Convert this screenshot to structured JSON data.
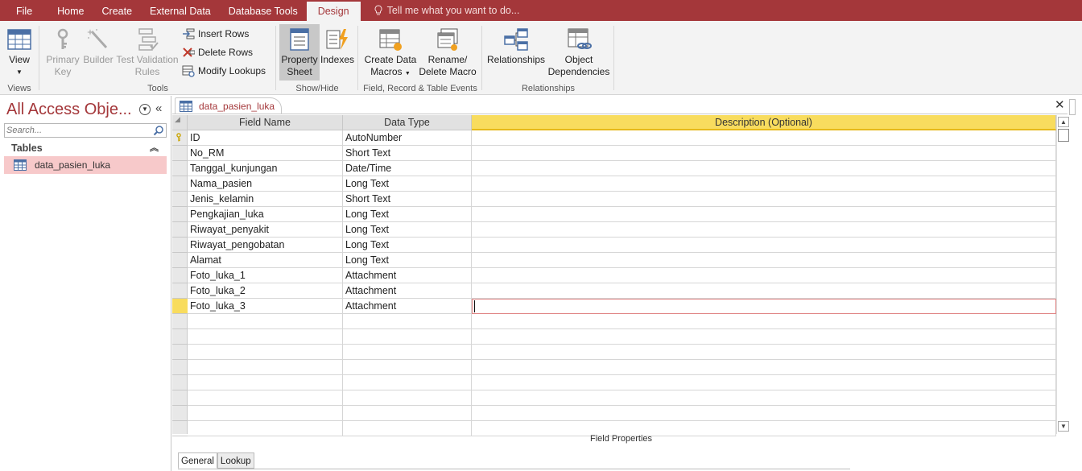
{
  "ribbon_tabs": [
    "File",
    "Home",
    "Create",
    "External Data",
    "Database Tools",
    "Design"
  ],
  "tell_me": "Tell me what you want to do...",
  "groups": {
    "views": {
      "label": "Views",
      "view_label": "View"
    },
    "tools": {
      "label": "Tools",
      "primary_key": [
        "Primary",
        "Key"
      ],
      "builder": "Builder",
      "test_validation": [
        "Test Validation",
        "Rules"
      ],
      "insert_rows": "Insert Rows",
      "delete_rows": "Delete Rows",
      "modify_lookups": "Modify Lookups"
    },
    "show_hide": {
      "label": "Show/Hide",
      "property_sheet": [
        "Property",
        "Sheet"
      ],
      "indexes": "Indexes"
    },
    "events": {
      "label": "Field, Record & Table Events",
      "create_data_macros": [
        "Create Data",
        "Macros"
      ],
      "rename_delete_macro": [
        "Rename/",
        "Delete Macro"
      ]
    },
    "relationships": {
      "label": "Relationships",
      "relationships": "Relationships",
      "object_dependencies": [
        "Object",
        "Dependencies"
      ]
    }
  },
  "nav": {
    "title": "All Access Obje...",
    "search_placeholder": "Search...",
    "section": "Tables",
    "items": [
      "data_pasien_luka"
    ]
  },
  "document": {
    "tab_label": "data_pasien_luka",
    "columns": [
      "Field Name",
      "Data Type",
      "Description (Optional)"
    ],
    "rows": [
      {
        "field": "ID",
        "type": "AutoNumber",
        "desc": "",
        "primary_key": true
      },
      {
        "field": "No_RM",
        "type": "Short Text",
        "desc": ""
      },
      {
        "field": "Tanggal_kunjungan",
        "type": "Date/Time",
        "desc": ""
      },
      {
        "field": "Nama_pasien",
        "type": "Long Text",
        "desc": ""
      },
      {
        "field": "Jenis_kelamin",
        "type": "Short Text",
        "desc": ""
      },
      {
        "field": "Pengkajian_luka",
        "type": "Long Text",
        "desc": ""
      },
      {
        "field": "Riwayat_penyakit",
        "type": "Long Text",
        "desc": ""
      },
      {
        "field": "Riwayat_pengobatan",
        "type": "Long Text",
        "desc": ""
      },
      {
        "field": "Alamat",
        "type": "Long Text",
        "desc": ""
      },
      {
        "field": "Foto_luka_1",
        "type": "Attachment",
        "desc": ""
      },
      {
        "field": "Foto_luka_2",
        "type": "Attachment",
        "desc": ""
      },
      {
        "field": "Foto_luka_3",
        "type": "Attachment",
        "desc": ""
      }
    ],
    "empty_rows": 8,
    "field_properties_label": "Field Properties",
    "property_tabs": [
      "General",
      "Lookup"
    ]
  },
  "colors": {
    "brand": "#a4373a",
    "header_active": "#f8dc5e",
    "nav_selected": "#f7c9ca"
  }
}
